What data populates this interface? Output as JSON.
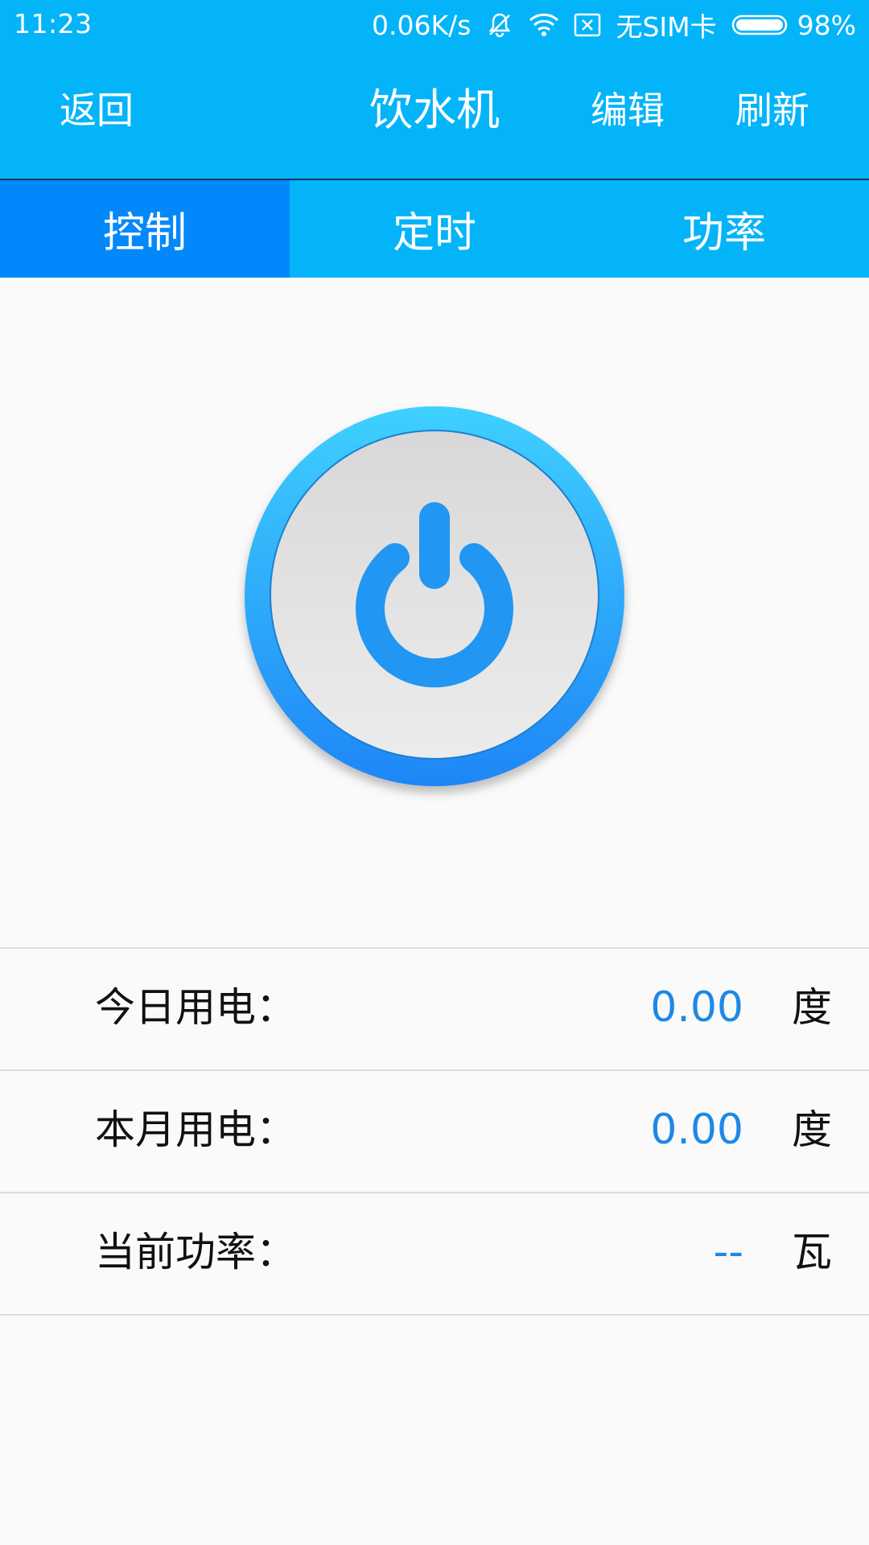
{
  "status_bar": {
    "time": "11:23",
    "network_speed": "0.06K/s",
    "sim_status": "无SIM卡",
    "battery_percent": "98%",
    "icons": [
      "muted-bell-icon",
      "wifi-icon",
      "no-sim-icon",
      "battery-icon"
    ]
  },
  "header": {
    "back_label": "返回",
    "title": "饮水机",
    "edit_label": "编辑",
    "refresh_label": "刷新"
  },
  "tabs": [
    {
      "label": "控制",
      "active": true
    },
    {
      "label": "定时",
      "active": false
    },
    {
      "label": "功率",
      "active": false
    }
  ],
  "power_button": {
    "icon": "power-icon",
    "ring_color_top": "#3fd0ff",
    "ring_color_bottom": "#1e86f7",
    "icon_color": "#2196f3"
  },
  "stats": [
    {
      "label": "今日用电：",
      "value": "0.00",
      "unit": "度"
    },
    {
      "label": "本月用电：",
      "value": "0.00",
      "unit": "度"
    },
    {
      "label": "当前功率：",
      "value": "--",
      "unit": "瓦"
    }
  ],
  "colors": {
    "header_bg": "#04b4f9",
    "active_tab_bg": "#0388fb",
    "value_text": "#1e88e5",
    "page_bg": "#fafafa"
  }
}
